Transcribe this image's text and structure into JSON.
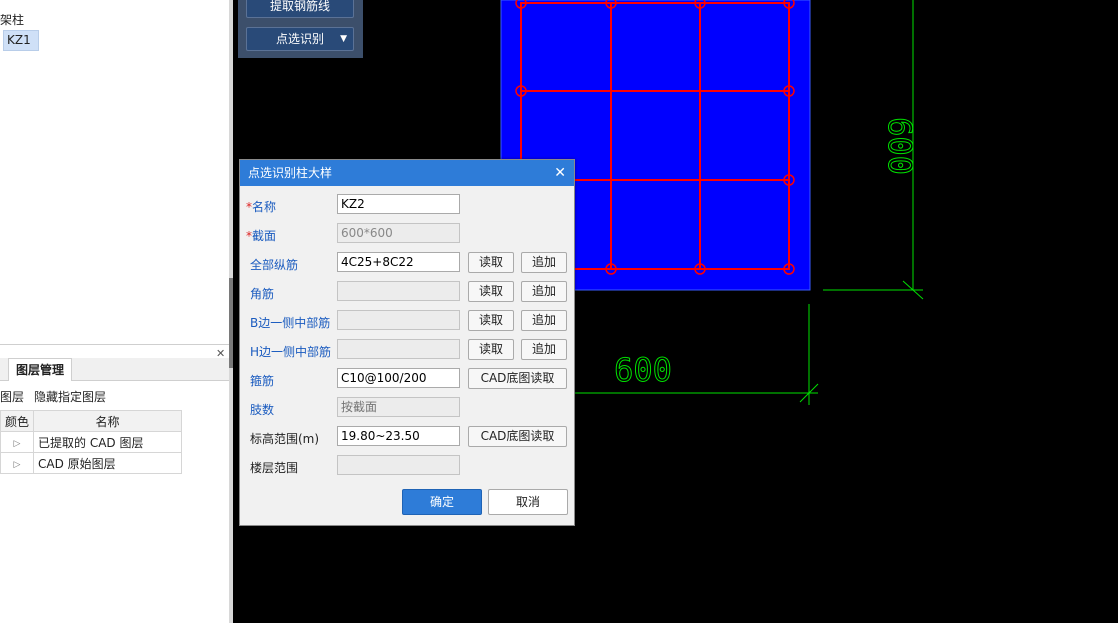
{
  "tree": {
    "node_label": "架柱",
    "selected_item": "KZ1"
  },
  "layer_panel": {
    "tab_label": "图层管理",
    "toolbar": {
      "show_label": "图层",
      "hide_label": "隐藏指定图层"
    },
    "columns": [
      "颜色",
      "名称"
    ],
    "rows": [
      {
        "name": "已提取的 CAD 图层"
      },
      {
        "name": "CAD 原始图层"
      }
    ]
  },
  "float_toolbar": {
    "extract_button": "提取钢筋线",
    "identify_button": "点选识别"
  },
  "cad": {
    "dim_vertical": "600",
    "dim_horizontal": "600",
    "colors": {
      "background": "#000000",
      "column_fill": "#0000ff",
      "rebar": "#ff0000",
      "dimension": "#00e000"
    }
  },
  "dialog": {
    "title": "点选识别柱大样",
    "fields": {
      "name": {
        "label": "名称",
        "value": "KZ2"
      },
      "section": {
        "label": "截面",
        "value": "600*600"
      },
      "all_bars": {
        "label": "全部纵筋",
        "value": "4C25+8C22"
      },
      "corner": {
        "label": "角筋",
        "value": ""
      },
      "b_side": {
        "label": "B边一侧中部筋",
        "value": ""
      },
      "h_side": {
        "label": "H边一侧中部筋",
        "value": ""
      },
      "stirrup": {
        "label": "箍筋",
        "value": "C10@100/200"
      },
      "legs": {
        "label": "肢数",
        "placeholder": "按截面"
      },
      "elevation": {
        "label": "标高范围(m)",
        "value": "19.80~23.50"
      },
      "floors": {
        "label": "楼层范围",
        "value": ""
      }
    },
    "read_label": "读取",
    "add_label": "追加",
    "cad_read_label": "CAD底图读取",
    "ok_label": "确定",
    "cancel_label": "取消"
  }
}
